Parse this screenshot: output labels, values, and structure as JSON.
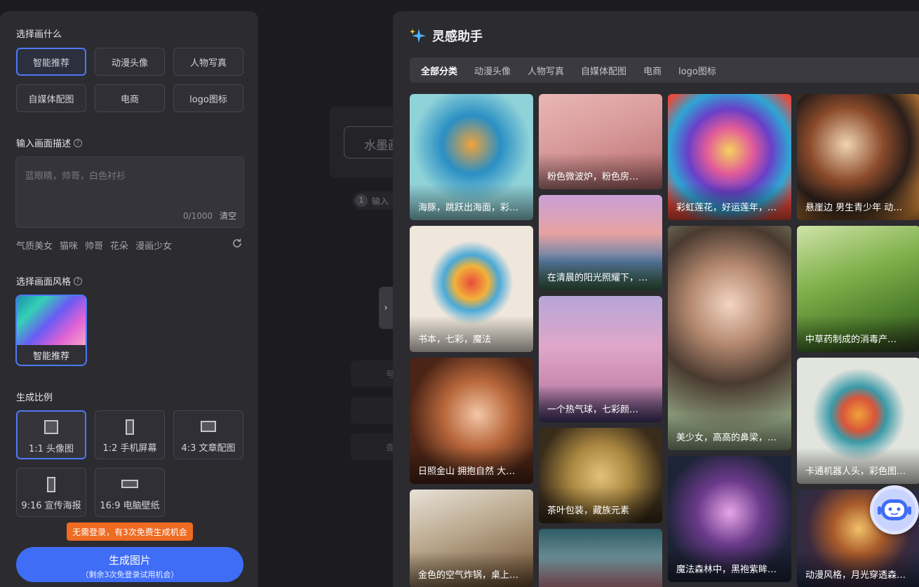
{
  "left": {
    "section_subject": "选择画什么",
    "subject_options": [
      "智能推荐",
      "动漫头像",
      "人物写真",
      "自媒体配图",
      "电商",
      "logo图标"
    ],
    "section_desc": "输入画面描述",
    "desc_placeholder": "蓝眼睛，帅哥，白色衬衫",
    "desc_count": "0/1000",
    "desc_clear": "清空",
    "quick_tags": [
      "气质美女",
      "猫咪",
      "帅哥",
      "花朵",
      "漫画少女"
    ],
    "section_style": "选择画面风格",
    "style_selected": "智能推荐",
    "section_ratio": "生成比例",
    "ratios": [
      "1:1 头像图",
      "1:2 手机屏幕",
      "4:3 文章配图",
      "9:16 宣传海报",
      "16:9 电脑壁纸"
    ],
    "free_tip": "无需登录，有3次免费生成机会",
    "generate_label": "生成图片",
    "generate_sub": "（剩余3次免登录试用机会）"
  },
  "middle": {
    "button_fragment": "水墨画",
    "step_num": "1",
    "step_fragment": "输入",
    "row_fragments": [
      "号",
      "",
      "查"
    ]
  },
  "right": {
    "title": "灵感助手",
    "categories": [
      "全部分类",
      "动漫头像",
      "人物写真",
      "自媒体配图",
      "电商",
      "logo图标"
    ],
    "cards": [
      "海豚，跳跃出海面，彩…",
      "书本，七彩，魔法",
      "日照金山 拥抱自然 大…",
      "金色的空气炸锅，桌上…",
      "粉色微波炉，粉色房…",
      "在清晨的阳光照耀下，…",
      "一个热气球，七彩颜…",
      "茶叶包装，藏族元素",
      "",
      "彩虹莲花，好运莲年，…",
      "美少女，高高的鼻梁，…",
      "魔法森林中，黑袍紫眸…",
      "悬崖边 男生青少年 动…",
      "中草药制成的消毒产…",
      "卡通机器人头，彩色图…",
      "动漫风格，月光穿透森…"
    ]
  },
  "colors": {
    "accent": "#3f6df5",
    "selected_border": "#4e79f5",
    "tip": "#ef6b22",
    "panel": "#2b2b30",
    "bg": "#1c1c1f"
  }
}
